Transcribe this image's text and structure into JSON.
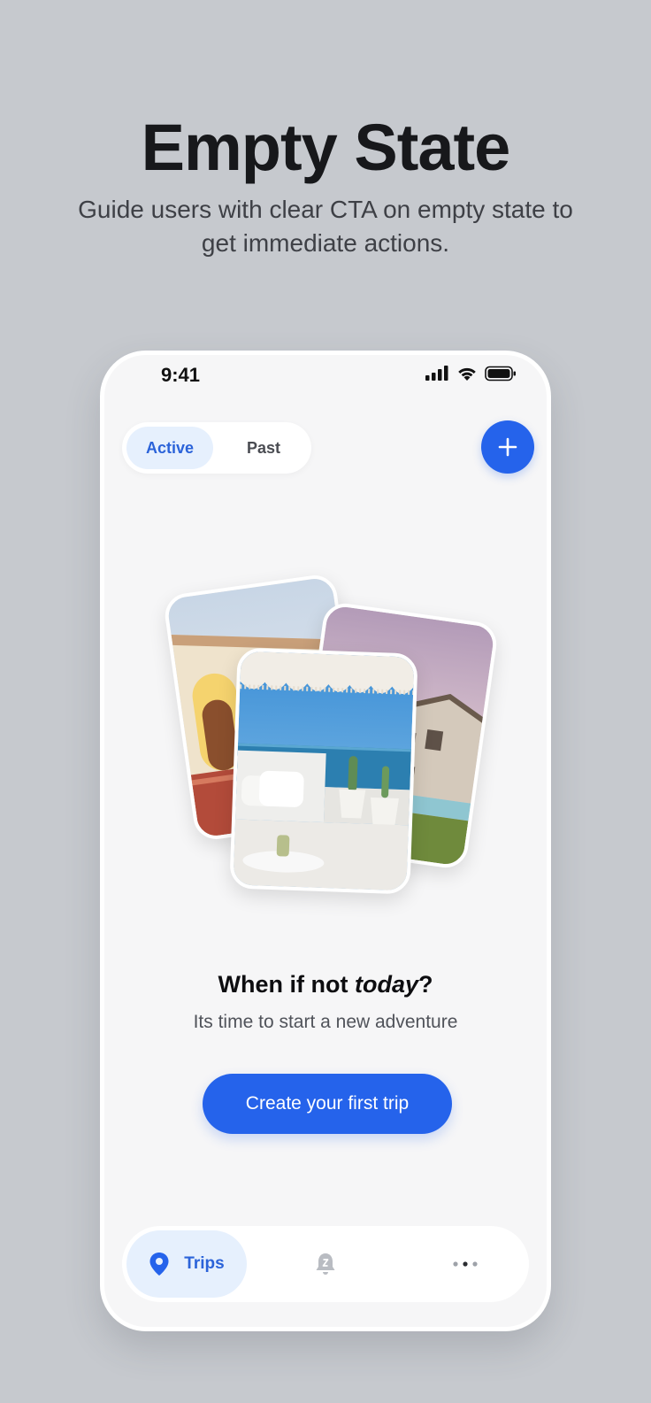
{
  "hero": {
    "title": "Empty State",
    "subtitle": "Guide users with clear CTA on empty state to get immediate actions."
  },
  "status_bar": {
    "time": "9:41",
    "icons": [
      "signal-icon",
      "wifi-icon",
      "battery-icon"
    ]
  },
  "segmented": {
    "active_label": "Active",
    "inactive_label": "Past"
  },
  "header": {
    "add_icon": "plus-icon"
  },
  "empty_state": {
    "title_prefix": "When if not ",
    "title_emphasis": "today",
    "title_suffix": "?",
    "subtitle": "Its time to start a new adventure",
    "cta_label": "Create your first trip"
  },
  "tab_bar": {
    "items": [
      {
        "label": "Trips",
        "icon": "location-pin-icon",
        "active": true
      },
      {
        "label": "",
        "icon": "bell-icon",
        "active": false
      },
      {
        "label": "",
        "icon": "more-dots-icon",
        "active": false
      }
    ]
  },
  "colors": {
    "primary": "#2563eb",
    "active_chip_bg": "#e6f0fd",
    "background": "#c6c9ce",
    "phone_bg": "#f6f6f7"
  }
}
